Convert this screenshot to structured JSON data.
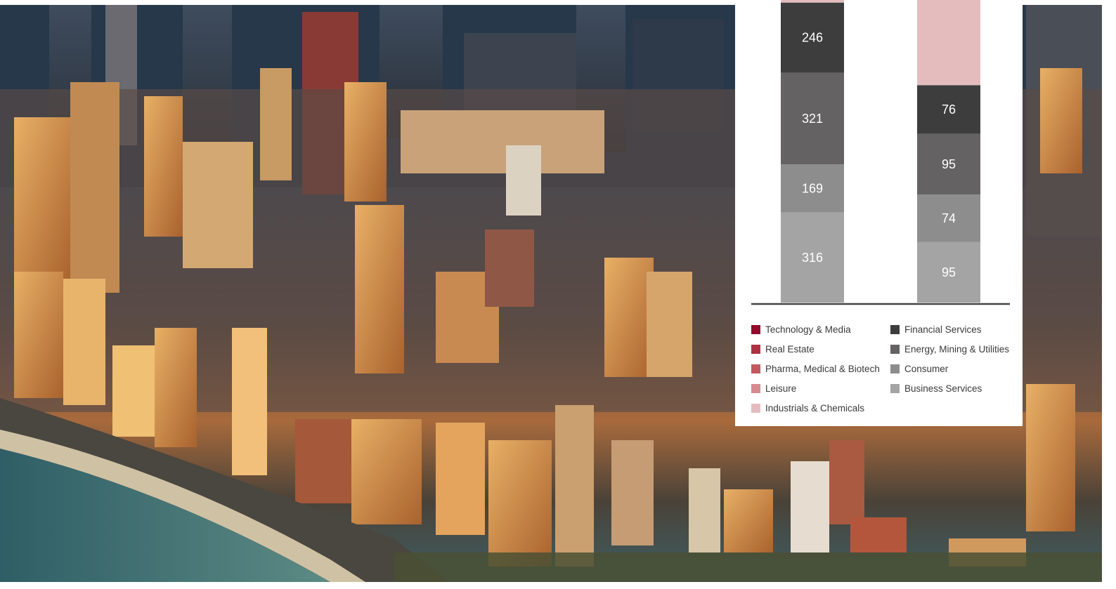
{
  "background": {
    "image": "aerial-city-photo",
    "colors": {
      "sky": "#1f2d3e",
      "buildings_warm": "#d19650",
      "buildings_dark": "#3b3c44",
      "water": "#3e6a70"
    }
  },
  "chart_data": {
    "type": "bar",
    "stacked": true,
    "categories": [
      "",
      ""
    ],
    "series": [
      {
        "name": "Business Services",
        "color": "#a5a4a4",
        "values": [
          316,
          95
        ]
      },
      {
        "name": "Consumer",
        "color": "#8e8d8d",
        "values": [
          169,
          74
        ]
      },
      {
        "name": "Energy, Mining & Utilities",
        "color": "#646262",
        "values": [
          321,
          95
        ]
      },
      {
        "name": "Financial Services",
        "color": "#3d3d3d",
        "values": [
          246,
          76
        ]
      },
      {
        "name": "Industrials & Chemicals",
        "color": "#e4bcbe",
        "values": [
          null,
          null
        ]
      },
      {
        "name": "Leisure",
        "color": "#d88b8f",
        "values": [
          null,
          null
        ]
      },
      {
        "name": "Pharma, Medical & Biotech",
        "color": "#c2585f",
        "values": [
          null,
          null
        ]
      },
      {
        "name": "Real Estate",
        "color": "#ad3140",
        "values": [
          null,
          null
        ]
      },
      {
        "name": "Technology & Media",
        "color": "#930a2a",
        "values": [
          null,
          null
        ]
      }
    ],
    "data_labels": [
      [
        "316",
        "169",
        "321",
        "246"
      ],
      [
        "95",
        "74",
        "95",
        "76"
      ]
    ],
    "legend": {
      "placement": "bottom",
      "columns": [
        [
          "Technology & Media",
          "Real Estate",
          "Pharma, Medical & Biotech",
          "Leisure",
          "Industrials & Chemicals"
        ],
        [
          "Financial Services",
          "Energy, Mining & Utilities",
          "Consumer",
          "Business Services"
        ]
      ]
    },
    "title": "",
    "xlabel": "",
    "ylabel": "",
    "grid": false
  }
}
